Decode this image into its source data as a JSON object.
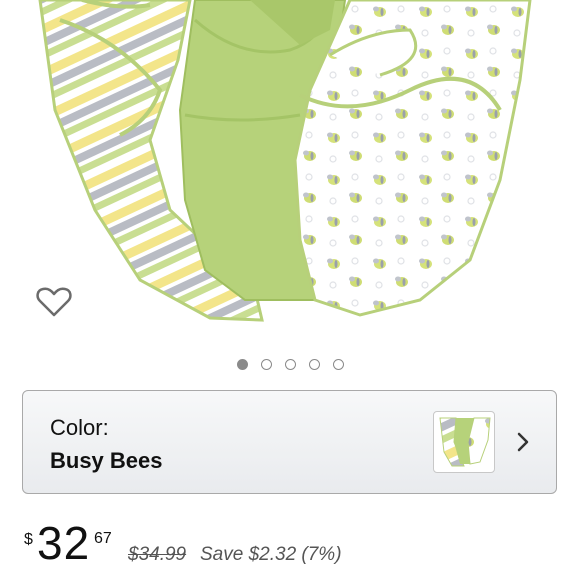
{
  "product": {
    "image_alt": "Three swaddle blankets: yellow/gray striped, solid green, and white with bee print",
    "wishlist_icon": "heart-outline-icon"
  },
  "carousel": {
    "dots": 5,
    "active_index": 0
  },
  "color_selector": {
    "label": "Color:",
    "value": "Busy Bees",
    "chevron_icon": "chevron-right-icon"
  },
  "price": {
    "currency_symbol": "$",
    "whole": "32",
    "fraction": "67",
    "list_price": "$34.99",
    "savings": "Save $2.32 (7%)"
  },
  "colors": {
    "stripe_yellow": "#f3e58a",
    "stripe_gray": "#b9bcc4",
    "green": "#b6d27a",
    "green_dark": "#9fbe5f",
    "dot_gray": "#8a8a8a"
  }
}
